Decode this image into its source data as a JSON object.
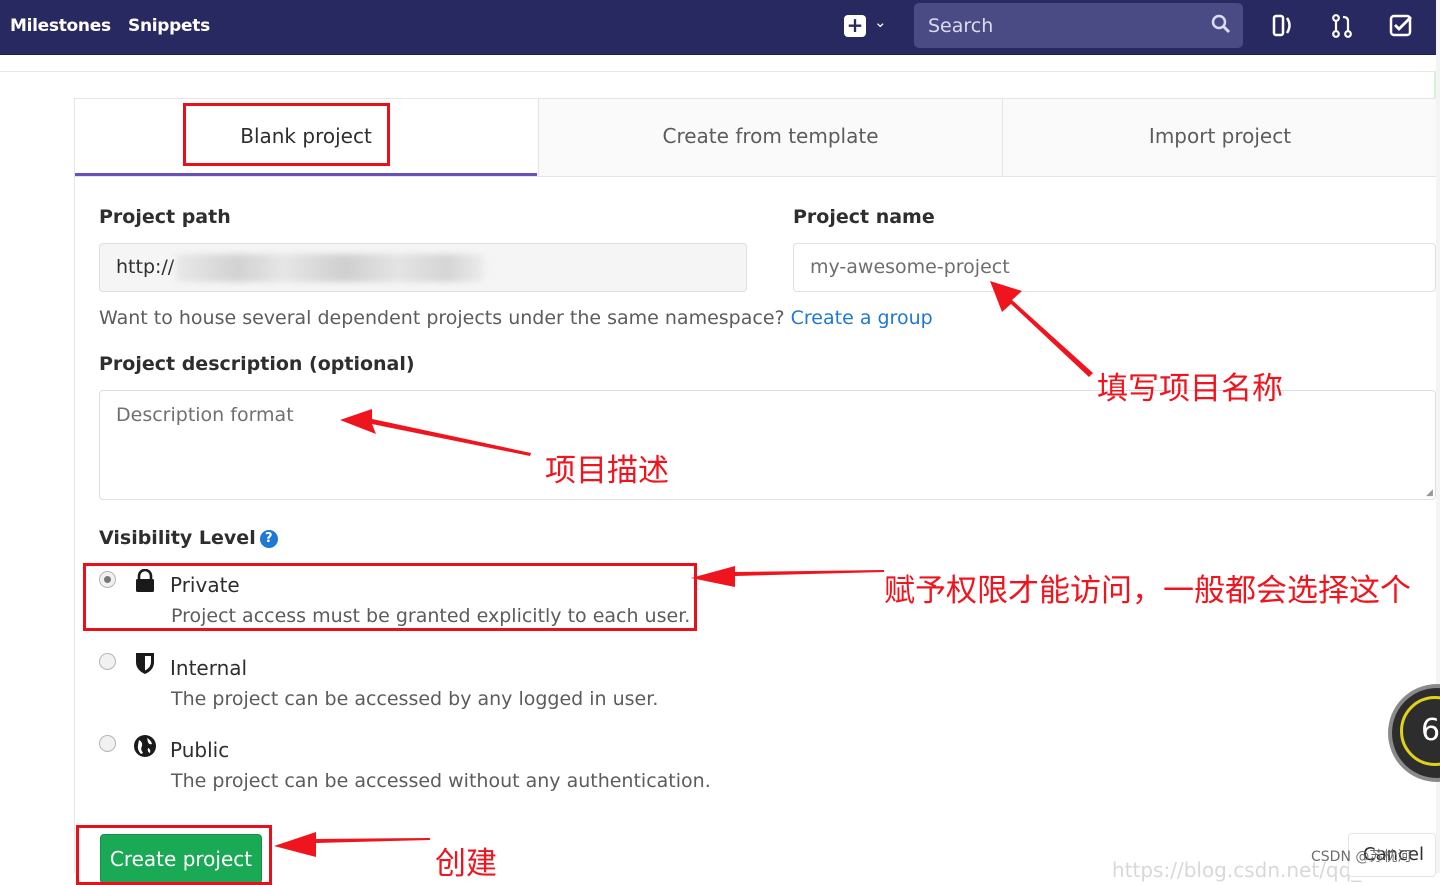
{
  "navbar": {
    "links": [
      "Milestones",
      "Snippets"
    ],
    "new_icon": "plus-square-icon",
    "search_placeholder": "Search",
    "icons": [
      "search-icon",
      "todos-icon",
      "merge-request-icon",
      "issues-check-icon"
    ]
  },
  "tabs": [
    "Blank project",
    "Create from template",
    "Import project"
  ],
  "form": {
    "path_label": "Project path",
    "path_value": "http://",
    "name_label": "Project name",
    "name_placeholder": "my-awesome-project",
    "group_help": "Want to house several dependent projects under the same namespace?",
    "group_link": "Create a group",
    "description_label": "Project description (optional)",
    "description_placeholder": "Description format",
    "visibility_label": "Visibility Level",
    "visibility_help_icon": "question-circle-icon",
    "visibility_options": [
      {
        "title": "Private",
        "desc": "Project access must be granted explicitly to each user.",
        "icon": "lock-icon",
        "selected": true
      },
      {
        "title": "Internal",
        "desc": "The project can be accessed by any logged in user.",
        "icon": "shield-icon",
        "selected": false
      },
      {
        "title": "Public",
        "desc": "The project can be accessed without any authentication.",
        "icon": "globe-icon",
        "selected": false
      }
    ],
    "create_button": "Create project",
    "cancel_button": "Cancel"
  },
  "annotations": {
    "name": "填写项目名称",
    "description": "项目描述",
    "private": "赋予权限才能访问，一般都会选择这个",
    "create": "创建"
  },
  "badge_number": "6",
  "watermark": "CSDN @苏枕河",
  "colors": {
    "navbar": "#292961",
    "accent_tab": "#6b4fbb",
    "link": "#1f78d1",
    "create_button": "#1aaa55",
    "annotation_red": "#f0141e"
  }
}
